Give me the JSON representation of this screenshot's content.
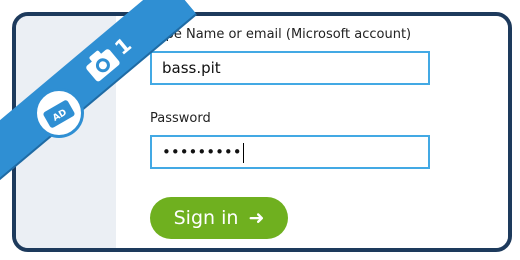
{
  "form": {
    "username_label": "Type Name or email (Microsoft account)",
    "username_value": "bass.pit",
    "password_label": "Password",
    "password_value": "•••••••••",
    "signin_label": "Sign in",
    "signin_arrow": "➜"
  },
  "ribbon": {
    "number": "1",
    "badge_text": "AD"
  },
  "colors": {
    "frame_border": "#1d3a5c",
    "field_border": "#43a9e4",
    "signin_bg": "#6fb01f",
    "ribbon": "#2f8fd3"
  },
  "icons": [
    "camera-icon",
    "ad-badge-icon",
    "arrow-right-icon"
  ]
}
